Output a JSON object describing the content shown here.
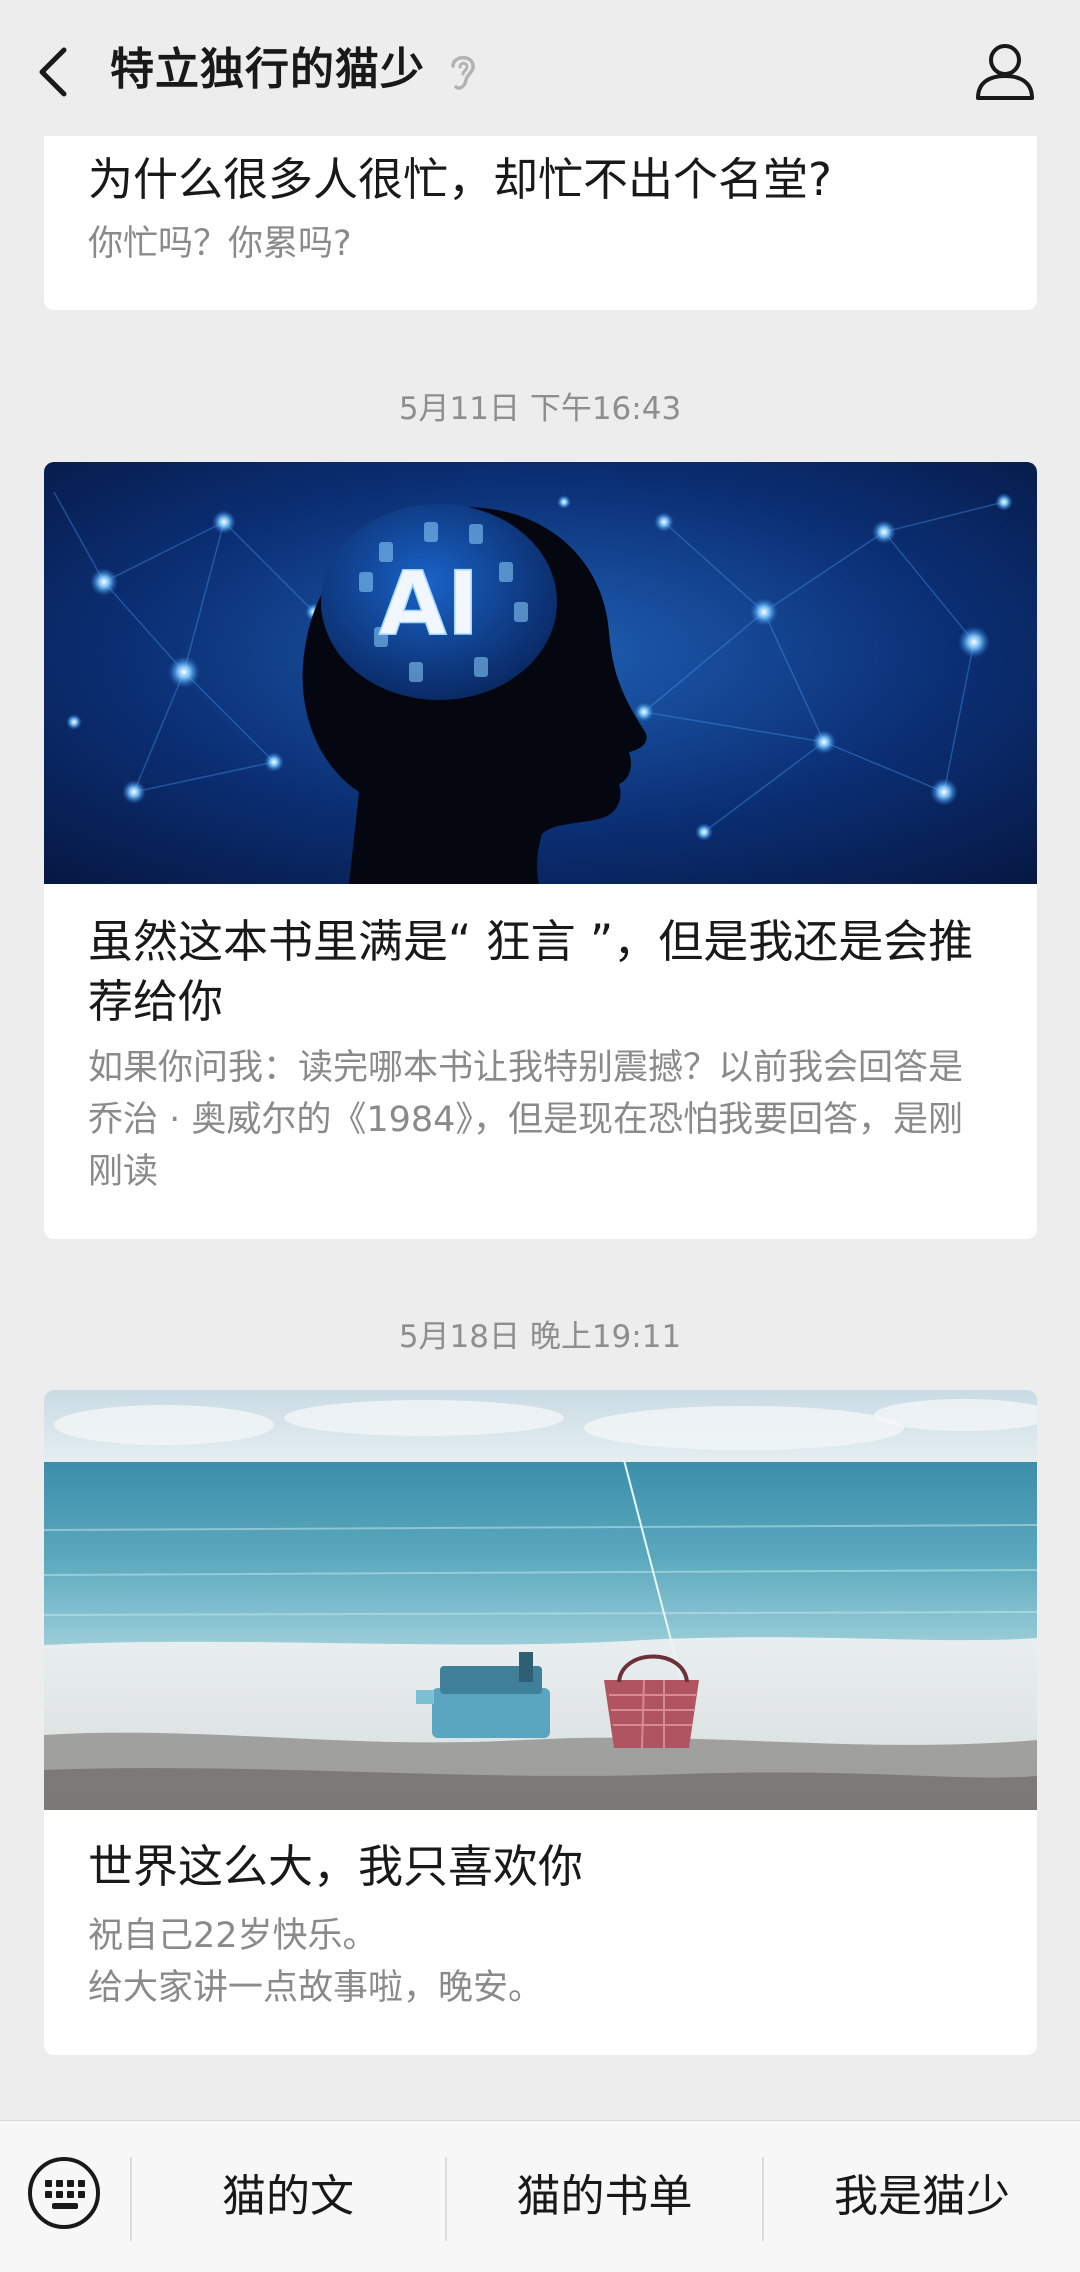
{
  "header": {
    "title": "特立独行的猫少"
  },
  "articles": [
    {
      "title": "为什么很多人很忙，却忙不出个名堂?",
      "digest": "你忙吗？你累吗?"
    },
    {
      "timestamp": "5月11日 下午16:43",
      "cover_text": "AI",
      "title": "虽然这本书里满是“ 狂言 ”，但是我还是会推荐给你",
      "digest": "如果你问我：读完哪本书让我特别震撼？以前我会回答是乔治 · 奥威尔的《1984》，但是现在恐怕我要回答，是刚刚读"
    },
    {
      "timestamp": "5月18日 晚上19:11",
      "title": "世界这么大，我只喜欢你",
      "digest_line1": "祝自己22岁快乐。",
      "digest_line2": "给大家讲一点故事啦，晚安。"
    }
  ],
  "bottom_menu": {
    "items": [
      "猫的文",
      "猫的书单",
      "我是猫少"
    ]
  },
  "colors": {
    "background": "#ededed",
    "card": "#ffffff",
    "title_text": "#191919",
    "secondary_text": "#8a8a8a"
  }
}
